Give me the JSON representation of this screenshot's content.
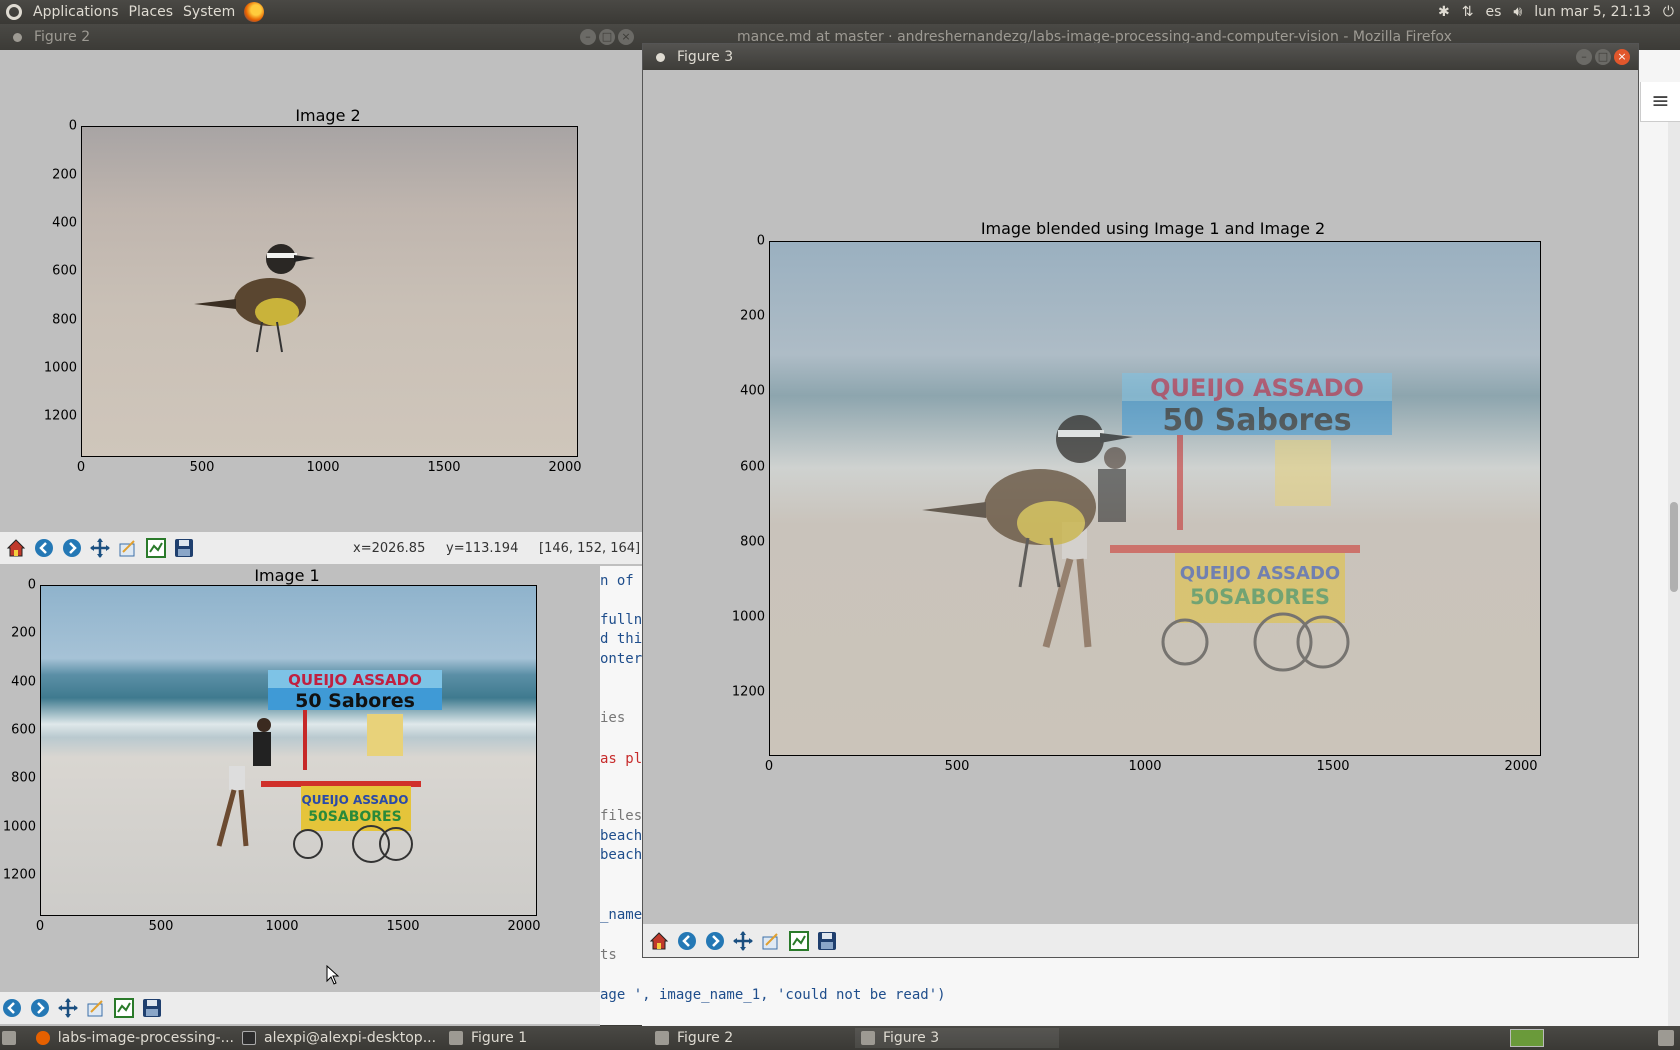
{
  "top_panel": {
    "menus": [
      "Applications",
      "Places",
      "System"
    ],
    "tray": {
      "bluetooth": "bluetooth-icon",
      "network": "network-icon",
      "keyboard": "es",
      "volume": "volume-icon",
      "datetime": "lun mar  5, 21:13",
      "power": "power-icon"
    }
  },
  "firefox": {
    "title": "mance.md at master · andreshernandezg/labs-image-processing-and-computer-vision - Mozilla Firefox"
  },
  "figure2": {
    "window_title": "Figure 2",
    "plot_title": "Image 2",
    "yticks": [
      "0",
      "200",
      "400",
      "600",
      "800",
      "1000",
      "1200"
    ],
    "xticks": [
      "0",
      "500",
      "1000",
      "1500",
      "2000"
    ],
    "readout": {
      "x": "x=2026.85",
      "y": "y=113.194",
      "rgb": "[146, 152, 164]"
    }
  },
  "figure1": {
    "window_title": "Figure 1",
    "plot_title": "Image 1",
    "yticks": [
      "0",
      "200",
      "400",
      "600",
      "800",
      "1000",
      "1200"
    ],
    "xticks": [
      "0",
      "500",
      "1000",
      "1500",
      "2000"
    ]
  },
  "figure3": {
    "window_title": "Figure 3",
    "plot_title": "Image blended using Image 1 and Image 2",
    "yticks": [
      "0",
      "200",
      "400",
      "600",
      "800",
      "1000",
      "1200"
    ],
    "xticks": [
      "0",
      "500",
      "1000",
      "1500",
      "2000"
    ]
  },
  "sign": {
    "line1": "QUEIJO ASSADO",
    "line2": "50 Sabores",
    "cart_text1": "QUEIJO ASSADO",
    "cart_text2": "50SABORES"
  },
  "code_lines": [
    "n of y",
    "fulln",
    "d this",
    "ontern",
    "ies",
    "as pl",
    "files",
    "beach_",
    "beach_",
    "_name_",
    "ts",
    "age ', image_name_1, 'could not be read')"
  ],
  "taskbar": {
    "tasks": [
      "labs-image-processing-...",
      "alexpi@alexpi-desktop...",
      "Figure 1",
      "Figure 2",
      "Figure 3"
    ]
  },
  "colors": {
    "panel": "#3c3b37",
    "plot_bg": "#bfbfbf",
    "close": "#e2572c"
  }
}
